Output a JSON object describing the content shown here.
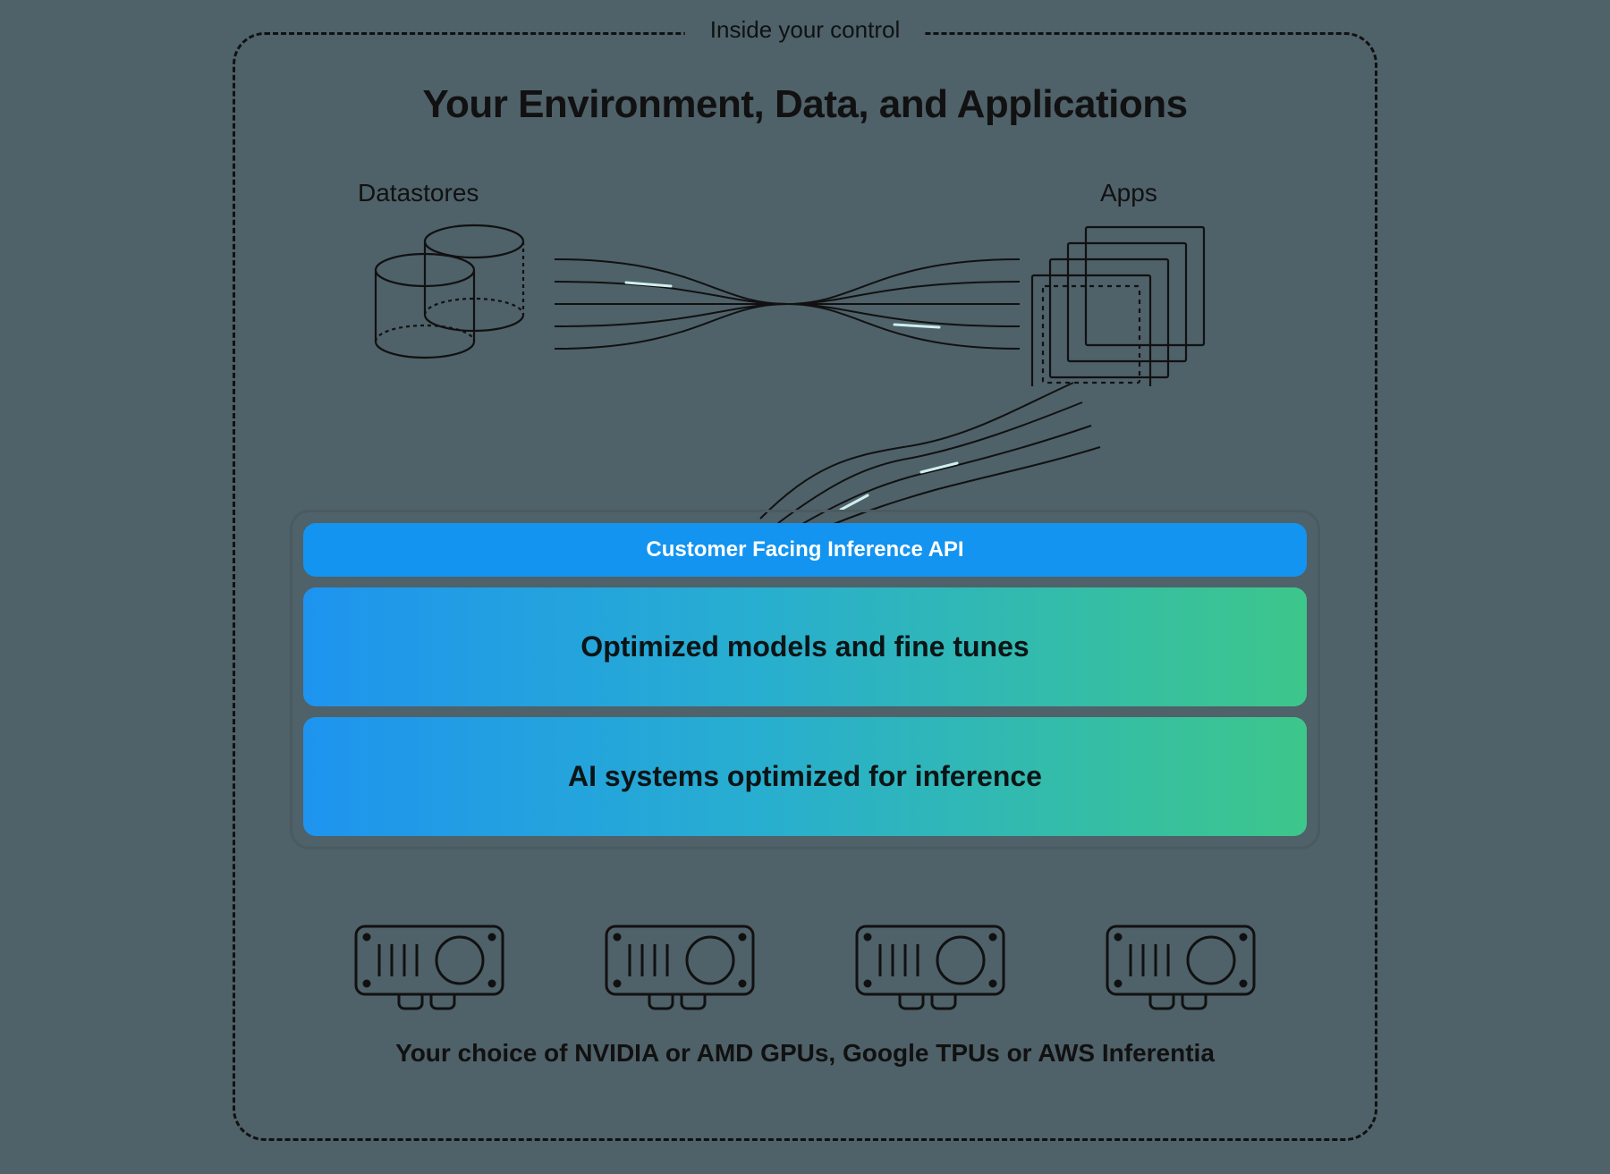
{
  "frame": {
    "label": "Inside your control"
  },
  "title": "Your Environment, Data, and Applications",
  "upper": {
    "datastores_label": "Datastores",
    "apps_label": "Apps"
  },
  "stack": {
    "api_label": "Customer Facing Inference API",
    "row1": "Optimized models and fine tunes",
    "row2": "AI systems optimized for inference"
  },
  "hardware": {
    "caption": "Your choice of NVIDIA or AMD GPUs, Google TPUs or AWS Inferentia",
    "count": 4
  }
}
